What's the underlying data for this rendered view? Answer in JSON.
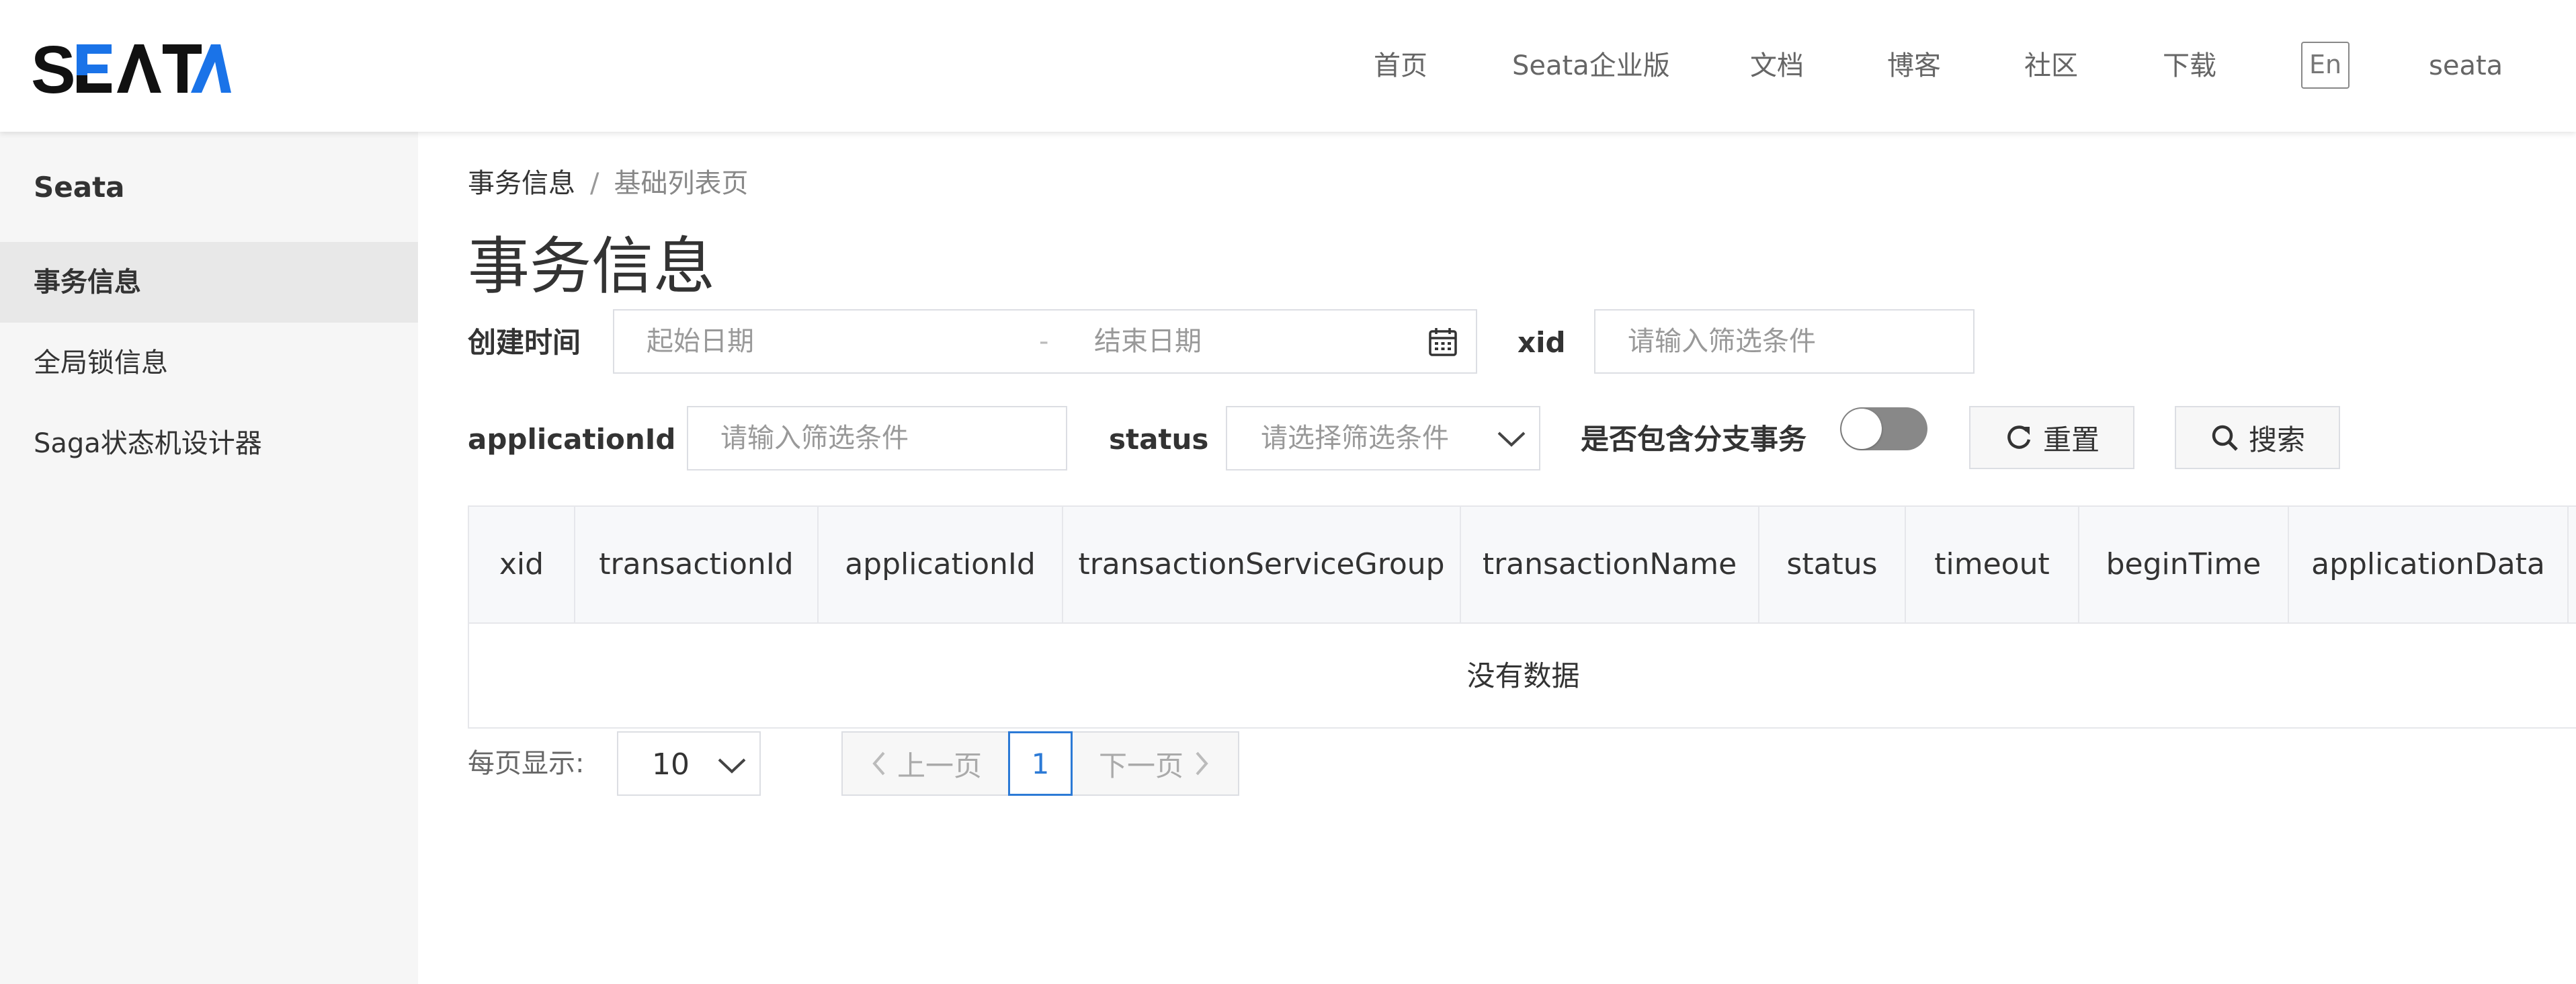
{
  "header": {
    "logo": "SEATA",
    "nav": [
      {
        "label": "首页"
      },
      {
        "label": "Seata企业版"
      },
      {
        "label": "文档"
      },
      {
        "label": "博客"
      },
      {
        "label": "社区"
      },
      {
        "label": "下载"
      }
    ],
    "lang": "En",
    "user": "seata"
  },
  "sidebar": {
    "title": "Seata",
    "items": [
      {
        "label": "事务信息",
        "active": true
      },
      {
        "label": "全局锁信息",
        "active": false
      },
      {
        "label": "Saga状态机设计器",
        "active": false
      }
    ]
  },
  "breadcrumb": {
    "parent": "事务信息",
    "separator": "/",
    "current": "基础列表页"
  },
  "page_title": "事务信息",
  "filters": {
    "created_time_label": "创建时间",
    "start_placeholder": "起始日期",
    "range_sep": "-",
    "end_placeholder": "结束日期",
    "xid_label": "xid",
    "xid_placeholder": "请输入筛选条件",
    "app_label": "applicationId",
    "app_placeholder": "请输入筛选条件",
    "status_label": "status",
    "status_placeholder": "请选择筛选条件",
    "branch_label": "是否包含分支事务",
    "branch_on": false,
    "reset_label": "重置",
    "search_label": "搜索"
  },
  "table": {
    "columns": [
      "xid",
      "transactionId",
      "applicationId",
      "transactionServiceGroup",
      "transactionName",
      "status",
      "timeout",
      "beginTime",
      "applicationData"
    ],
    "rows": [],
    "empty_text": "没有数据"
  },
  "pagination": {
    "page_size_label": "每页显示:",
    "page_size": "10",
    "prev_label": "上一页",
    "current_page": "1",
    "next_label": "下一页"
  },
  "colors": {
    "accent": "#2c7ad6",
    "logo_blue": "#1a73e8",
    "sidebar_bg": "#f6f6f6",
    "active_item_bg": "#e8e8e8"
  }
}
